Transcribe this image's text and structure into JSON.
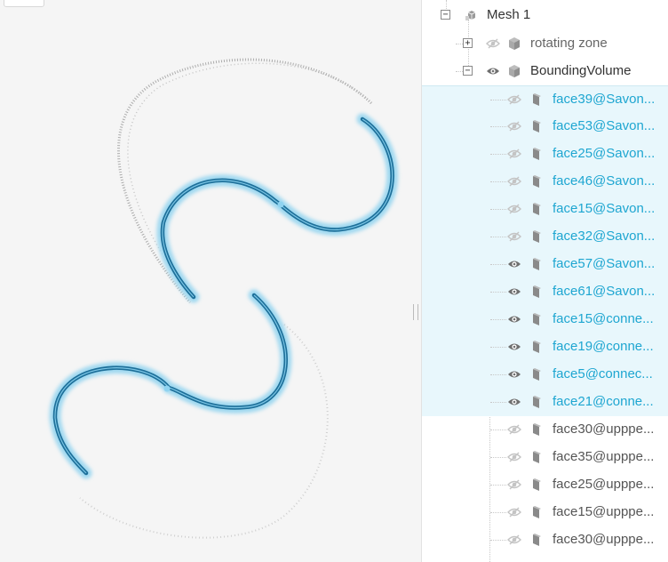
{
  "tree": {
    "root": {
      "label": "Mesh 1",
      "toggle": "−"
    },
    "rotating": {
      "label": "rotating zone",
      "toggle": "+"
    },
    "bounding": {
      "label": "BoundingVolume",
      "toggle": "−"
    },
    "faces": [
      {
        "label": "face39@Savon...",
        "selected": true,
        "visible": false
      },
      {
        "label": "face53@Savon...",
        "selected": true,
        "visible": false
      },
      {
        "label": "face25@Savon...",
        "selected": true,
        "visible": false
      },
      {
        "label": "face46@Savon...",
        "selected": true,
        "visible": false
      },
      {
        "label": "face15@Savon...",
        "selected": true,
        "visible": false
      },
      {
        "label": "face32@Savon...",
        "selected": true,
        "visible": false
      },
      {
        "label": "face57@Savon...",
        "selected": true,
        "visible": true
      },
      {
        "label": "face61@Savon...",
        "selected": true,
        "visible": true
      },
      {
        "label": "face15@conne...",
        "selected": true,
        "visible": true
      },
      {
        "label": "face19@conne...",
        "selected": true,
        "visible": true
      },
      {
        "label": "face5@connec...",
        "selected": true,
        "visible": true
      },
      {
        "label": "face21@conne...",
        "selected": true,
        "visible": true
      },
      {
        "label": "face30@upppe...",
        "selected": false,
        "visible": false
      },
      {
        "label": "face35@upppe...",
        "selected": false,
        "visible": false
      },
      {
        "label": "face25@upppe...",
        "selected": false,
        "visible": false
      },
      {
        "label": "face15@upppe...",
        "selected": false,
        "visible": false
      },
      {
        "label": "face30@upppe...",
        "selected": false,
        "visible": false
      }
    ]
  },
  "colors": {
    "selection_bg": "#e8f7fc",
    "selected_text": "#1ea6d1",
    "highlight_curve": "#1d6f99",
    "glow": "#9fd8f0"
  },
  "icons": {
    "eye": "eye-icon",
    "eye_hidden": "eye-slash-icon",
    "cube": "cube-icon",
    "face": "face-icon"
  }
}
